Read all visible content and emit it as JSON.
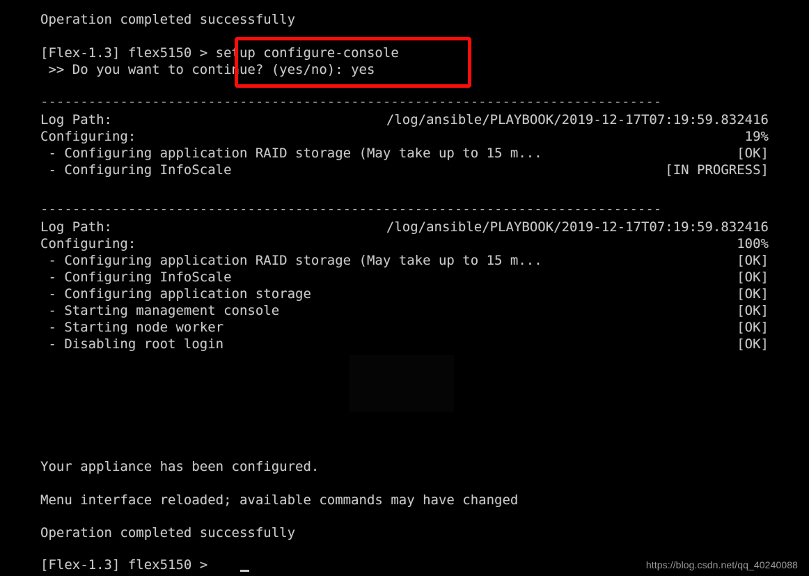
{
  "terminal": {
    "colors": {
      "background": "#000000",
      "text": "#c9c9c9",
      "highlight_border": "#fb0d09",
      "watermark": "#9a9a9a"
    },
    "separator": "------------------------------------------------------------------------------",
    "prompt_prefix": "[Flex-1.3] flex5150 >",
    "lines": {
      "op_success_top": "Operation completed successfully",
      "command_line": "[Flex-1.3] flex5150 > setup configure-console",
      "confirm_line": " >> Do you want to continue? (yes/no): yes",
      "appliance_configured": "Your appliance has been configured.",
      "menu_reloaded": "Menu interface reloaded; available commands may have changed",
      "op_success_bottom": "Operation completed successfully",
      "final_prompt": "[Flex-1.3] flex5150 > "
    },
    "command": {
      "typed": "setup configure-console",
      "confirm_prompt": " >> Do you want to continue? (yes/no):",
      "confirm_answer": "yes"
    },
    "block1": {
      "log_path_label": "Log Path:",
      "log_path_value": "/log/ansible/PLAYBOOK/2019-12-17T07:19:59.832416",
      "configuring_label": "Configuring:",
      "configuring_value": "19%",
      "tasks": [
        {
          "label": " - Configuring application RAID storage (May take up to 15 m...",
          "status": "[OK]"
        },
        {
          "label": " - Configuring InfoScale",
          "status": "[IN PROGRESS]"
        }
      ]
    },
    "block2": {
      "log_path_label": "Log Path:",
      "log_path_value": "/log/ansible/PLAYBOOK/2019-12-17T07:19:59.832416",
      "configuring_label": "Configuring:",
      "configuring_value": "100%",
      "tasks": [
        {
          "label": " - Configuring application RAID storage (May take up to 15 m...",
          "status": "[OK]"
        },
        {
          "label": " - Configuring InfoScale",
          "status": "[OK]"
        },
        {
          "label": " - Configuring application storage",
          "status": "[OK]"
        },
        {
          "label": " - Starting management console",
          "status": "[OK]"
        },
        {
          "label": " - Starting node worker",
          "status": "[OK]"
        },
        {
          "label": " - Disabling root login",
          "status": "[OK]"
        }
      ]
    },
    "watermark": "https://blog.csdn.net/qq_40240088"
  }
}
